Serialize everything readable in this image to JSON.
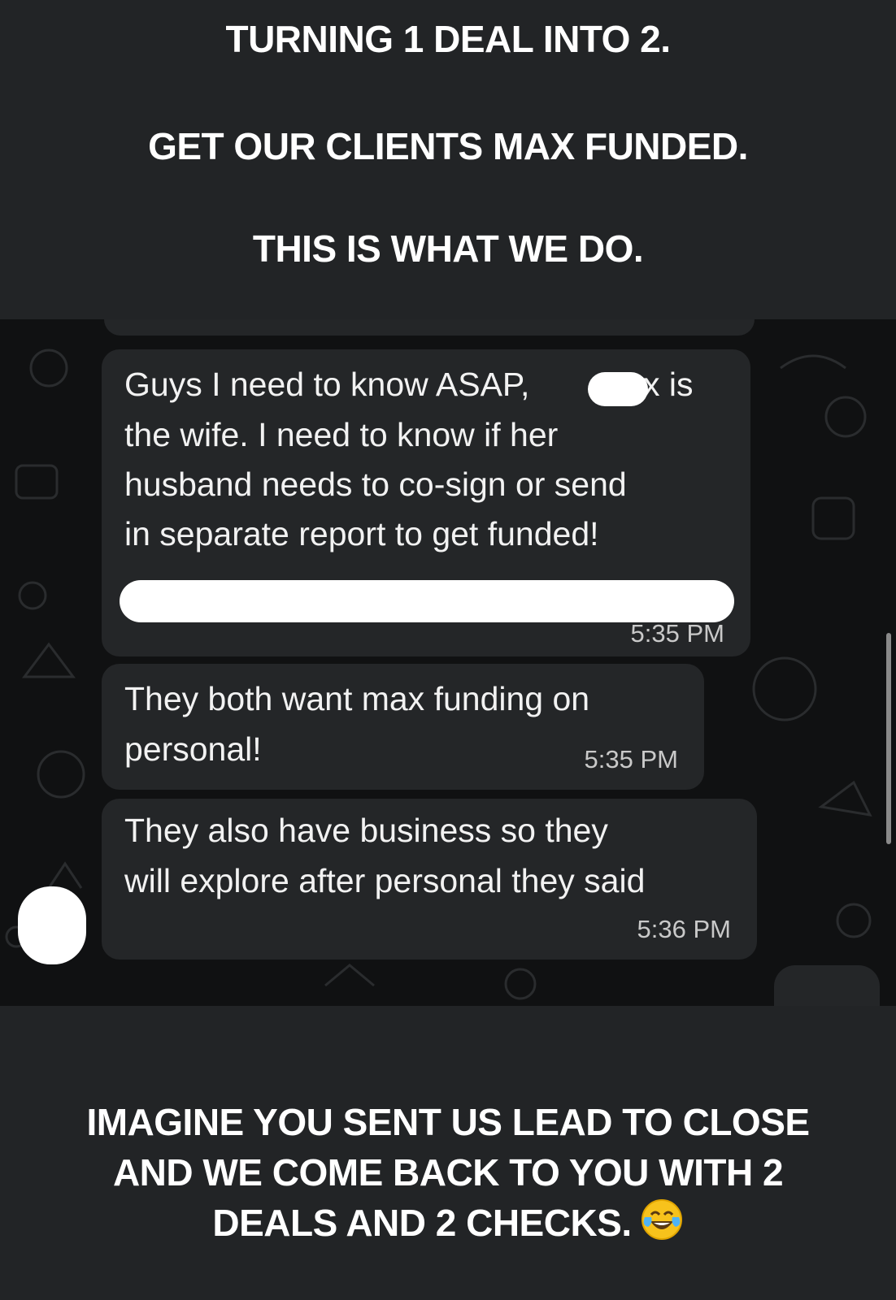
{
  "caption_top": {
    "line1": "TURNING 1 DEAL INTO 2.",
    "line2": "GET OUR CLIENTS MAX FUNDED.",
    "line3": "THIS IS WHAT WE DO."
  },
  "messages": [
    {
      "lines": [
        "Guys I need to know ASAP,",
        "x is",
        "the wife. I need to know if her",
        "husband needs to co-sign or send",
        "in separate report to get funded!"
      ],
      "time": "5:35 PM"
    },
    {
      "lines": [
        "They both want max funding on",
        "personal!"
      ],
      "time": "5:35 PM"
    },
    {
      "lines": [
        "They also have business so they",
        "will explore after personal they said"
      ],
      "time": "5:36 PM"
    }
  ],
  "caption_bottom": {
    "line1": "IMAGINE YOU SENT US LEAD TO CLOSE",
    "line2": "AND WE COME BACK TO YOU WITH 2",
    "line3": "DEALS AND 2 CHECKS."
  },
  "icons": {
    "emoji": "face-with-tears-of-joy-icon"
  },
  "colors": {
    "caption_bg": "#222426",
    "chat_bg": "#101112",
    "bubble_bg": "#242628",
    "text": "#ffffff",
    "timestamp": "#c9c9c9"
  }
}
